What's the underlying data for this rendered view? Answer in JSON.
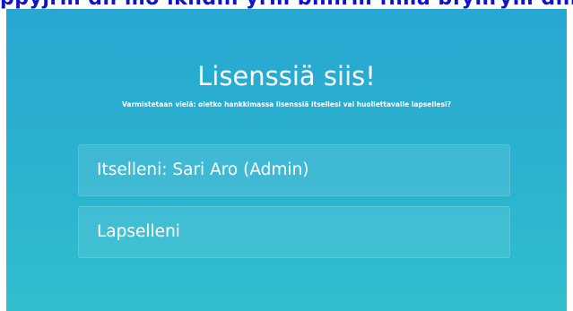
{
  "banner": {
    "text": "ppyjrm dh mo ikhdin yrm bnhrm flma bfyllrym dnnm"
  },
  "dialog": {
    "title": "Lisenssiä siis!",
    "subtitle": "Varmistetaan vielä: oletko hankkimassa lisenssiä itsellesi vai huollettavalle lapsellesi?",
    "options": [
      {
        "label": "Itselleni: Sari Aro (Admin)"
      },
      {
        "label": "Lapselleni"
      }
    ]
  },
  "colors": {
    "panel_top": "#27a7d2",
    "panel_bottom": "#2fbfcd",
    "text": "#ffffff"
  }
}
